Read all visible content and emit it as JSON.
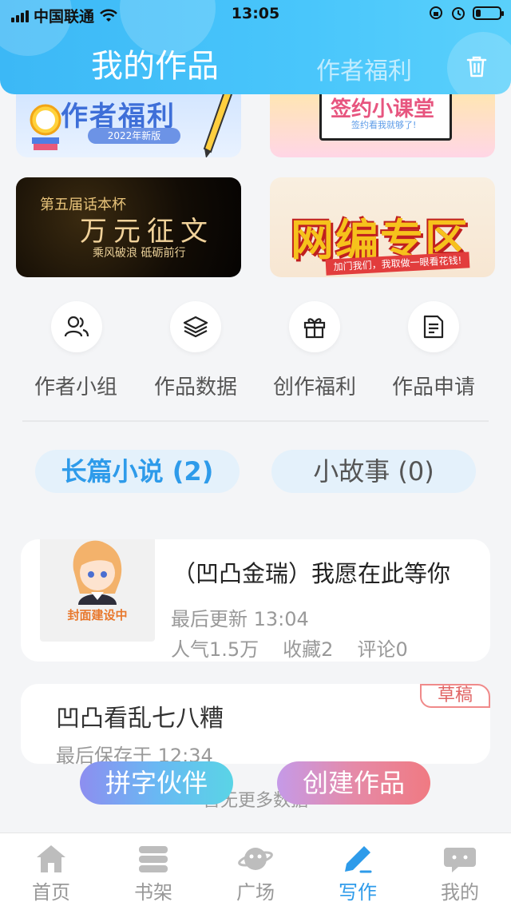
{
  "status_bar": {
    "carrier": "中国联通",
    "time": "13:05"
  },
  "header": {
    "title": "我的作品",
    "secondary_tab": "作者福利"
  },
  "banners": [
    {
      "text": "作者福利",
      "sub": "2022年新版"
    },
    {
      "text": "签约小课堂",
      "sub": "签约看我就够了!"
    },
    {
      "text_top": "第五届话本杯",
      "text": "万元征文",
      "sub": "乘风破浪 砥砺前行"
    },
    {
      "text": "网编专区",
      "sub": "加门我们，我取做一眼看花钱!"
    }
  ],
  "quick_actions": [
    {
      "label": "作者小组",
      "icon": "people-icon"
    },
    {
      "label": "作品数据",
      "icon": "layers-icon"
    },
    {
      "label": "创作福利",
      "icon": "gift-icon"
    },
    {
      "label": "作品申请",
      "icon": "document-icon"
    }
  ],
  "tabs": {
    "long_novel": "长篇小说 (2)",
    "short_story": "小故事 (0)"
  },
  "works": [
    {
      "cover_text": "封面建设中",
      "title": "（凹凸金瑞）我愿在此等你",
      "last_update": "最后更新 13:04",
      "popularity": "人气1.5万",
      "favorites": "收藏2",
      "comments": "评论0"
    }
  ],
  "draft": {
    "title": "凹凸看乱七八糟",
    "last_saved": "最后保存于 12:34",
    "badge": "草稿"
  },
  "more_text": "暂无更多数据",
  "floating_buttons": {
    "partner": "拼字伙伴",
    "create": "创建作品"
  },
  "bottom_nav": [
    {
      "label": "首页",
      "icon": "home-icon"
    },
    {
      "label": "书架",
      "icon": "bookshelf-icon"
    },
    {
      "label": "广场",
      "icon": "planet-icon"
    },
    {
      "label": "写作",
      "icon": "pen-icon",
      "active": true
    },
    {
      "label": "我的",
      "icon": "chat-bubble-icon"
    }
  ],
  "colors": {
    "accent": "#2e9bea",
    "header": "#49c6fb",
    "draft_badge": "#e06464"
  }
}
